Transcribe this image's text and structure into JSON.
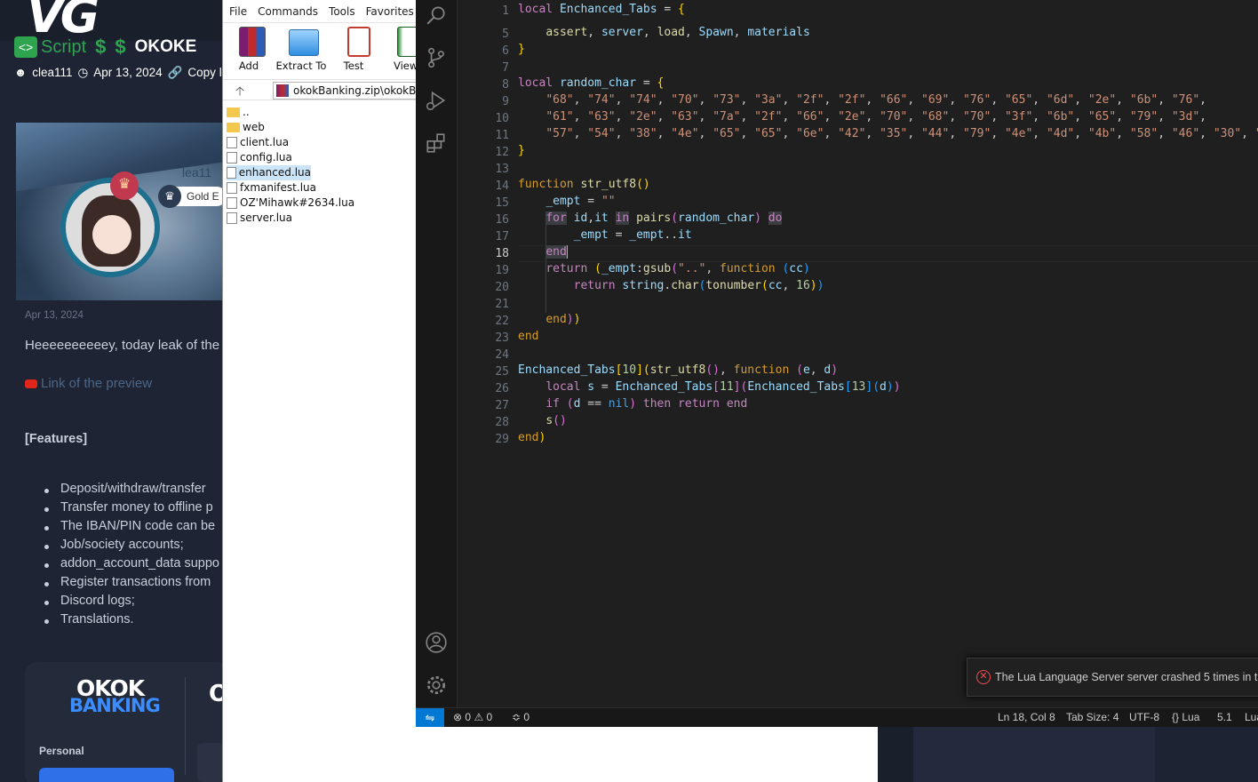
{
  "forum": {
    "logo": "VG",
    "prefix_label": "Script",
    "prefix_icons": [
      "$",
      "$"
    ],
    "title_fragment": "OKOKE",
    "author": "clea111",
    "date": "Apr 13, 2024",
    "copy_link": "Copy li",
    "badge": "Gold E",
    "username_ghost": "lea11",
    "post_date": "Apr 13, 2024",
    "intro": "Heeeeeeeeeey, today leak of the",
    "preview_link": "Link of the preview",
    "features_heading": "[Features]",
    "features": [
      "Deposit/withdraw/transfer",
      "Transfer money to offline p",
      "The IBAN/PIN code can be",
      "Job/society accounts;",
      "addon_account_data suppo",
      "Register transactions from",
      "Discord logs;",
      "Translations."
    ],
    "banner_okok": "OKOK",
    "banner_banking": "BANKING",
    "banner_cut": "O",
    "personal_label": "Personal"
  },
  "winrar": {
    "menu": [
      "File",
      "Commands",
      "Tools",
      "Favorites"
    ],
    "toolbar": [
      {
        "label": "Add",
        "icon": "add-archive-icon"
      },
      {
        "label": "Extract To",
        "icon": "extract-folder-icon"
      },
      {
        "label": "Test",
        "icon": "test-clipboard-icon"
      },
      {
        "label": "View",
        "icon": "view-book-icon"
      }
    ],
    "up_icon": "up-arrow-icon",
    "path": "okokBanking.zip\\okokBan",
    "files": [
      {
        "name": "..",
        "type": "folder"
      },
      {
        "name": "web",
        "type": "folder"
      },
      {
        "name": "client.lua",
        "type": "file"
      },
      {
        "name": "config.lua",
        "type": "file"
      },
      {
        "name": "enhanced.lua",
        "type": "file",
        "selected": true
      },
      {
        "name": "fxmanifest.lua",
        "type": "file"
      },
      {
        "name": "OZ'Mihawk#2634.lua",
        "type": "file"
      },
      {
        "name": "server.lua",
        "type": "file"
      }
    ]
  },
  "vscode": {
    "activity_icons": [
      "search-icon",
      "source-control-icon",
      "run-debug-icon",
      "extensions-icon",
      "accounts-icon",
      "settings-gear-icon"
    ],
    "line_numbers": [
      "1",
      "5",
      "6",
      "7",
      "8",
      "9",
      "10",
      "11",
      "12",
      "13",
      "14",
      "15",
      "16",
      "17",
      "18",
      "19",
      "20",
      "21",
      "22",
      "23",
      "24",
      "25",
      "26",
      "27",
      "28",
      "29"
    ],
    "current_line": "18",
    "toast_message": "The Lua Language Server server crashed 5 times in t",
    "status": {
      "errors": "0",
      "warnings": "0",
      "ports": "0",
      "position": "Ln 18, Col 8",
      "tab_size": "Tab Size: 4",
      "encoding": "UTF-8",
      "language": "Lua",
      "version": "5.1",
      "extra": "Lua"
    }
  }
}
